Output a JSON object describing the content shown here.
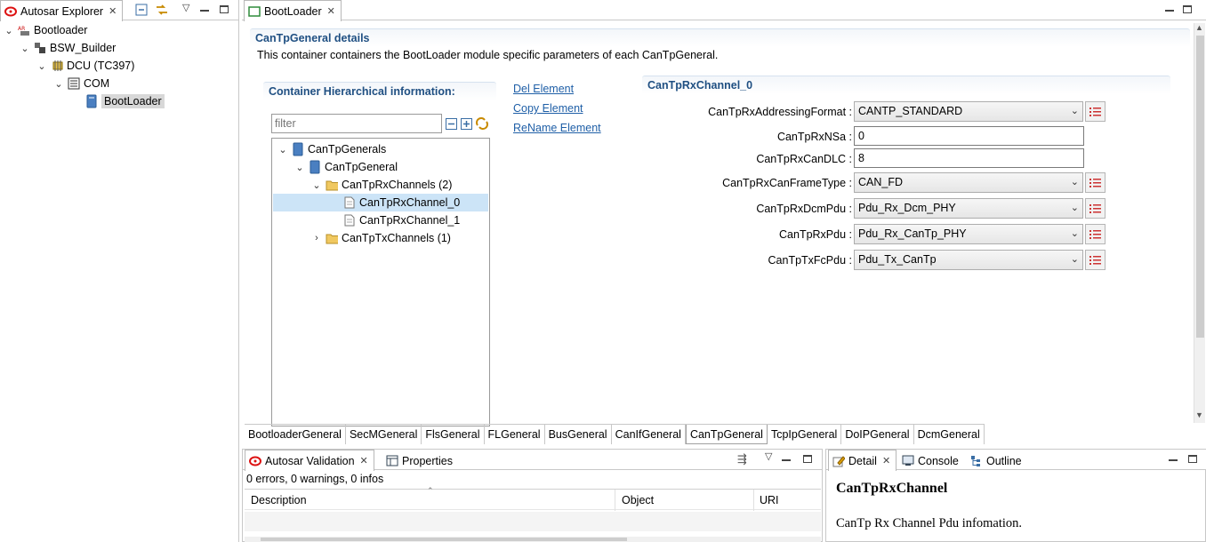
{
  "explorer": {
    "tab_label": "Autosar Explorer",
    "tree": [
      {
        "label": "Bootloader",
        "level": 0,
        "expanded": true,
        "icon": "autosar-project-icon"
      },
      {
        "label": "BSW_Builder",
        "level": 1,
        "expanded": true,
        "icon": "builder-icon"
      },
      {
        "label": "DCU (TC397)",
        "level": 2,
        "expanded": true,
        "icon": "chip-icon"
      },
      {
        "label": "COM",
        "level": 3,
        "expanded": true,
        "icon": "com-module-icon"
      },
      {
        "label": "BootLoader",
        "level": 4,
        "selected": true,
        "icon": "module-icon"
      }
    ]
  },
  "editor": {
    "tab_label": "BootLoader",
    "details_title": "CanTpGeneral details",
    "details_desc": "This container containers the BootLoader module specific parameters of each CanTpGeneral.",
    "hier_title": "Container Hierarchical information:",
    "filter_placeholder": "filter",
    "links": {
      "del": "Del Element",
      "copy": "Copy Element",
      "rename": "ReName Element"
    },
    "hier_tree": [
      {
        "label": "CanTpGenerals",
        "level": 0,
        "expanded": true,
        "icon": "container-icon"
      },
      {
        "label": "CanTpGeneral",
        "level": 1,
        "expanded": true,
        "icon": "container-icon"
      },
      {
        "label": "CanTpRxChannels (2)",
        "level": 2,
        "expanded": true,
        "icon": "folder-icon"
      },
      {
        "label": "CanTpRxChannel_0",
        "level": 3,
        "selected": true,
        "icon": "file-icon"
      },
      {
        "label": "CanTpRxChannel_1",
        "level": 3,
        "icon": "file-icon"
      },
      {
        "label": "CanTpTxChannels (1)",
        "level": 2,
        "expanded": false,
        "icon": "folder-icon"
      }
    ],
    "channel_title": "CanTpRxChannel_0",
    "params": [
      {
        "label": "CanTpRxAddressingFormat :",
        "value": "CANTP_STANDARD",
        "kind": "combo"
      },
      {
        "label": "CanTpRxNSa :",
        "value": "0",
        "kind": "text"
      },
      {
        "label": "CanTpRxCanDLC :",
        "value": "8",
        "kind": "text"
      },
      {
        "label": "CanTpRxCanFrameType :",
        "value": "CAN_FD",
        "kind": "combo"
      },
      {
        "label": "CanTpRxDcmPdu :",
        "value": "Pdu_Rx_Dcm_PHY",
        "kind": "combo"
      },
      {
        "label": "CanTpRxPdu :",
        "value": "Pdu_Rx_CanTp_PHY",
        "kind": "combo"
      },
      {
        "label": "CanTpTxFcPdu :",
        "value": "Pdu_Tx_CanTp",
        "kind": "combo"
      }
    ],
    "bottom_tabs": [
      "BootloaderGeneral",
      "SecMGeneral",
      "FlsGeneral",
      "FLGeneral",
      "BusGeneral",
      "CanIfGeneral",
      "CanTpGeneral",
      "TcpIpGeneral",
      "DoIPGeneral",
      "DcmGeneral"
    ],
    "active_bottom_tab": "CanTpGeneral"
  },
  "validation": {
    "tab_label": "Autosar Validation",
    "properties_label": "Properties",
    "summary": "0 errors, 0 warnings, 0 infos",
    "columns": [
      "Description",
      "Object",
      "URI"
    ]
  },
  "detail": {
    "tab_label": "Detail",
    "console_label": "Console",
    "outline_label": "Outline",
    "heading": "CanTpRxChannel",
    "text": "CanTp Rx Channel Pdu infomation."
  },
  "colors": {
    "section_title": "#1f4f82",
    "link": "#1f5fa7",
    "selection": "#cce4f7"
  }
}
